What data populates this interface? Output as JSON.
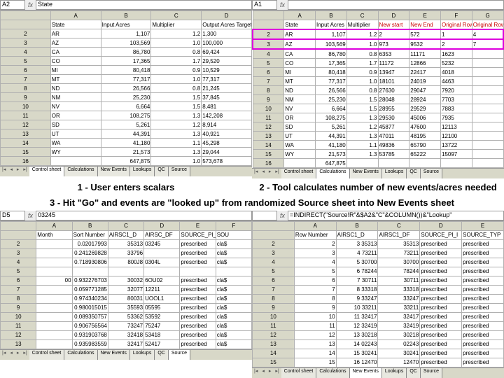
{
  "captions": {
    "c1": "1 - User enters scalars",
    "c2": "2 - Tool calculates number of new events/acres needed",
    "c3": "3 - Hit \"Go\" and events are \"looked up\" from randomized Source sheet into New Events sheet"
  },
  "tabs": [
    "Control sheet",
    "Calculations",
    "New Events",
    "Lookups",
    "QC",
    "Source"
  ],
  "q1": {
    "namebox": "A2",
    "formula": "State",
    "cols": [
      "",
      "A",
      "B",
      "C",
      "D"
    ],
    "head": [
      "",
      "State",
      "Input Acres",
      "Multiplier",
      "Output Acres Target"
    ],
    "rows": [
      [
        "2",
        "AR",
        "1,107",
        "1.2",
        "1,300"
      ],
      [
        "3",
        "AZ",
        "103,569",
        "1.0",
        "100,000"
      ],
      [
        "4",
        "CA",
        "86,780",
        "0.8",
        "69,424"
      ],
      [
        "5",
        "CO",
        "17,365",
        "1.7",
        "29,520"
      ],
      [
        "6",
        "MI",
        "80,418",
        "0.9",
        "10,529"
      ],
      [
        "7",
        "MT",
        "77,317",
        "1.0",
        "77,317"
      ],
      [
        "8",
        "ND",
        "26,566",
        "0.8",
        "21,245"
      ],
      [
        "9",
        "NM",
        "25,230",
        "1.5",
        "37,845"
      ],
      [
        "10",
        "NV",
        "6,664",
        "1.5",
        "8,481"
      ],
      [
        "11",
        "OR",
        "108,275",
        "1.3",
        "142,208"
      ],
      [
        "12",
        "SD",
        "5,261",
        "1.2",
        "8,914"
      ],
      [
        "13",
        "UT",
        "44,391",
        "1.3",
        "40,921"
      ],
      [
        "14",
        "WA",
        "41,180",
        "1.1",
        "45,298"
      ],
      [
        "15",
        "WY",
        "21,573",
        "1.3",
        "29,044"
      ],
      [
        "16",
        "",
        "647,875",
        "1.0",
        "573,678"
      ]
    ]
  },
  "q2": {
    "namebox": "A1",
    "formula": "",
    "cols": [
      "",
      "A",
      "B",
      "C",
      "D",
      "E",
      "F",
      "G"
    ],
    "head": [
      "",
      "State",
      "Input Acres",
      "Multiplier",
      "New start",
      "New End",
      "Original Row Start",
      "Original Row"
    ],
    "rows": [
      [
        "2",
        "AR",
        "1,107",
        "1.2",
        "2",
        "572",
        "1",
        "4"
      ],
      [
        "3",
        "AZ",
        "103,569",
        "1.0",
        "973",
        "9532",
        "2",
        "7"
      ],
      [
        "4",
        "CA",
        "86,780",
        "0.8",
        "6353",
        "11171",
        "1623",
        ""
      ],
      [
        "5",
        "CO",
        "17,365",
        "1.7",
        "11172",
        "12866",
        "5232",
        ""
      ],
      [
        "6",
        "MI",
        "80,418",
        "0.9",
        "13947",
        "22417",
        "4018",
        ""
      ],
      [
        "7",
        "MT",
        "77,317",
        "1.0",
        "18101",
        "24019",
        "4463",
        ""
      ],
      [
        "8",
        "ND",
        "26,566",
        "0.8",
        "27630",
        "29047",
        "7920",
        ""
      ],
      [
        "9",
        "NM",
        "25,230",
        "1.5",
        "28048",
        "28924",
        "7703",
        ""
      ],
      [
        "10",
        "NV",
        "6,664",
        "1.5",
        "28955",
        "29529",
        "7883",
        ""
      ],
      [
        "11",
        "OR",
        "108,275",
        "1.3",
        "29530",
        "45006",
        "7935",
        ""
      ],
      [
        "12",
        "SD",
        "5,261",
        "1.2",
        "45877",
        "47600",
        "12113",
        ""
      ],
      [
        "13",
        "UT",
        "44,391",
        "1.3",
        "47011",
        "48195",
        "12100",
        ""
      ],
      [
        "14",
        "WA",
        "41,180",
        "1.1",
        "49836",
        "65790",
        "13722",
        ""
      ],
      [
        "15",
        "WY",
        "21,573",
        "1.3",
        "53785",
        "65222",
        "15097",
        ""
      ],
      [
        "16",
        "",
        "647,875",
        "",
        "",
        "",
        "",
        ""
      ]
    ]
  },
  "q3": {
    "namebox": "D5",
    "formula": "03245",
    "cols": [
      "",
      "A",
      "B",
      "C",
      "D",
      "E",
      "F"
    ],
    "head": [
      "",
      "Month",
      "Sort Number",
      "AIRSC1_D",
      "AIRSC_DF",
      "SOURCE_PI_I",
      "SOU"
    ],
    "rows": [
      [
        "2",
        "",
        "0.02017993",
        "35313",
        "03245",
        "prescribed",
        "cla$"
      ],
      [
        "3",
        "",
        "0.241269828",
        "33796",
        "",
        "prescribed",
        "cla$"
      ],
      [
        "4",
        "",
        "0.718930806",
        "800J8",
        "0304L",
        "prescribed",
        "cla$"
      ],
      [
        "5",
        "",
        "",
        "",
        "",
        "",
        ""
      ],
      [
        "6",
        "00",
        "0.932276703",
        "30032",
        "6OU02",
        "prescribed",
        "cla$"
      ],
      [
        "7",
        "",
        "0.059771285",
        "32077",
        "12211",
        "prescribed",
        "cla$"
      ],
      [
        "8",
        "",
        "0.974340234",
        "80031",
        "UOOL1",
        "prescribed",
        "cla$"
      ],
      [
        "9",
        "",
        "0.980015015",
        "35593",
        "05595",
        "prescribed",
        "cla$"
      ],
      [
        "10",
        "",
        "0.089350757",
        "53362",
        "53592",
        "prescribed",
        "cla$"
      ],
      [
        "11",
        "",
        "0.906756564",
        "73247",
        "75247",
        "prescribed",
        "cla$"
      ],
      [
        "12",
        "",
        "0.931903768",
        "32418",
        "53418",
        "prescribed",
        "cla$"
      ],
      [
        "13",
        "",
        "0.935983559",
        "32417",
        "52417",
        "prescribed",
        "cla$"
      ]
    ]
  },
  "q4": {
    "namebox": "",
    "formula": "=INDIRECT(\"Source!R\"&$A2&\"C\"&COLUMN())&\"Lookup\"",
    "cols": [
      "",
      "A",
      "B",
      "C",
      "D",
      "E"
    ],
    "head": [
      "",
      "Row Number",
      "AIRSC1_D",
      "AIRSC1_DF",
      "SOURCE_PI_I",
      "SOURCE_TYP"
    ],
    "rows": [
      [
        "2",
        "2",
        "3 35313",
        "35313",
        "prescribed",
        "prescribed"
      ],
      [
        "3",
        "3",
        "4 73211",
        "73211",
        "prescribed",
        "prescribed"
      ],
      [
        "4",
        "4",
        "5 30700",
        "30700",
        "prescribed",
        "prescribed"
      ],
      [
        "5",
        "5",
        "6 78244",
        "78244",
        "prescribed",
        "prescribed"
      ],
      [
        "6",
        "6",
        "7 30711",
        "30711",
        "prescribed",
        "prescribed"
      ],
      [
        "7",
        "7",
        "8 33318",
        "33318",
        "prescribed",
        "prescribed"
      ],
      [
        "8",
        "8",
        "9 33247",
        "33247",
        "prescribed",
        "prescribed"
      ],
      [
        "9",
        "9",
        "10 33211",
        "33211",
        "prescribed",
        "prescribed"
      ],
      [
        "10",
        "10",
        "11 32417",
        "32417",
        "prescribed",
        "prescribed"
      ],
      [
        "11",
        "11",
        "12 32419",
        "32419",
        "prescribed",
        "prescribed"
      ],
      [
        "12",
        "12",
        "13 30218",
        "30218",
        "prescribed",
        "prescribed"
      ],
      [
        "13",
        "13",
        "14 02243",
        "02243",
        "prescribed",
        "prescribed"
      ],
      [
        "14",
        "14",
        "15 30241",
        "30241",
        "prescribed",
        "prescribed"
      ],
      [
        "15",
        "15",
        "16 12470",
        "12470",
        "prescribed",
        "prescribed"
      ]
    ]
  }
}
